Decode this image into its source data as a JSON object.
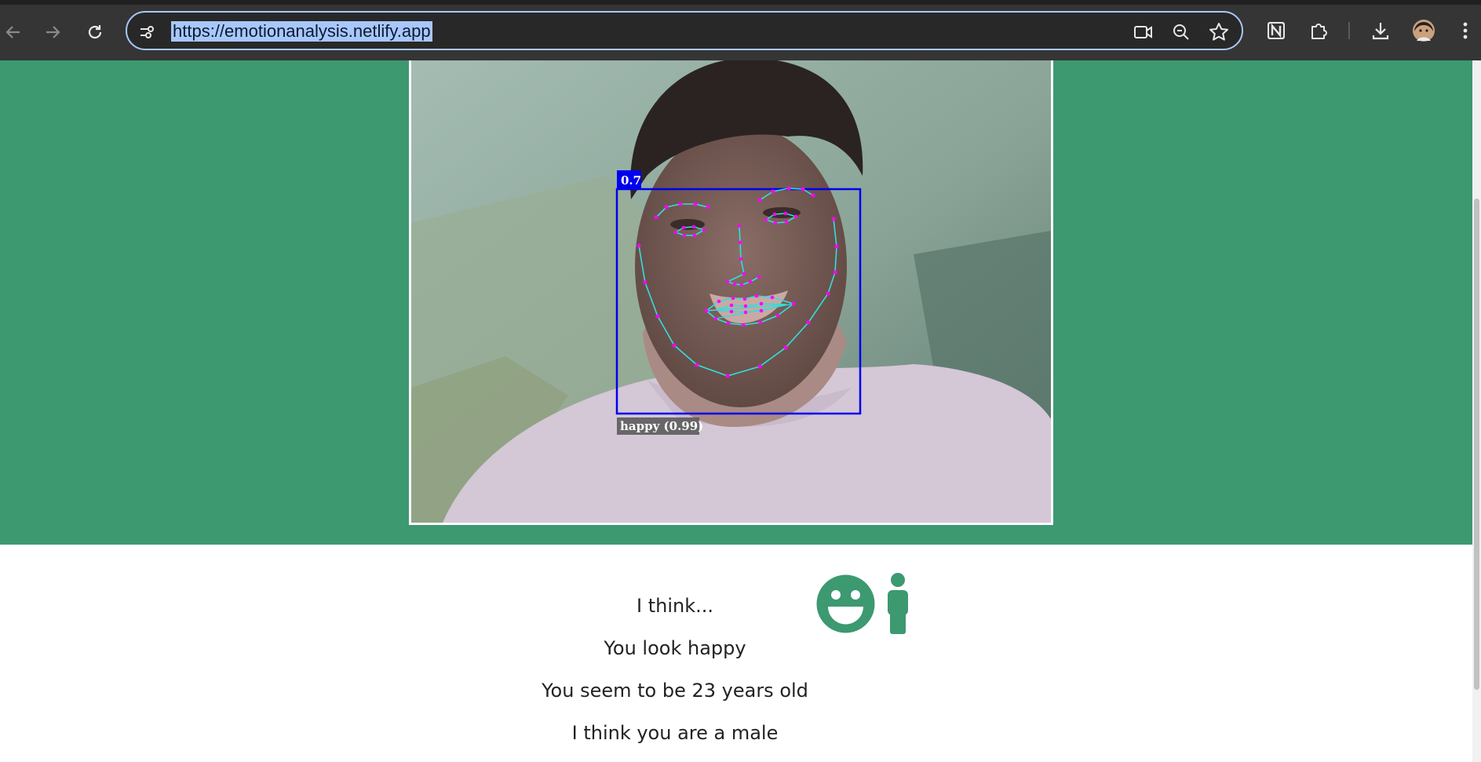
{
  "browser": {
    "url": "https://emotionanalysis.netlify.app",
    "icons": [
      "back-arrow-icon",
      "forward-arrow-icon",
      "reload-icon",
      "site-info-icon",
      "camera-icon",
      "zoom-icon",
      "star-icon",
      "notion-extension-icon",
      "extensions-puzzle-icon",
      "download-icon",
      "profile-avatar",
      "more-menu-icon"
    ]
  },
  "detection": {
    "confidence_label": "0.7",
    "expression_label": "happy (0.99)",
    "box_color": "#0000ee",
    "landmark_line_color": "#33dddd",
    "landmark_point_color": "#ff00ff"
  },
  "results": {
    "intro": "I think...",
    "emotion": "You look happy",
    "age": "You seem to be 23 years old",
    "gender": "I think you are a male",
    "icons": [
      "smiley-face-icon",
      "person-icon"
    ],
    "icon_color": "#3c9970"
  },
  "colors": {
    "hero_bg": "#3c9970",
    "chrome_bg": "#353535",
    "url_highlight": "#a8c7fa"
  }
}
